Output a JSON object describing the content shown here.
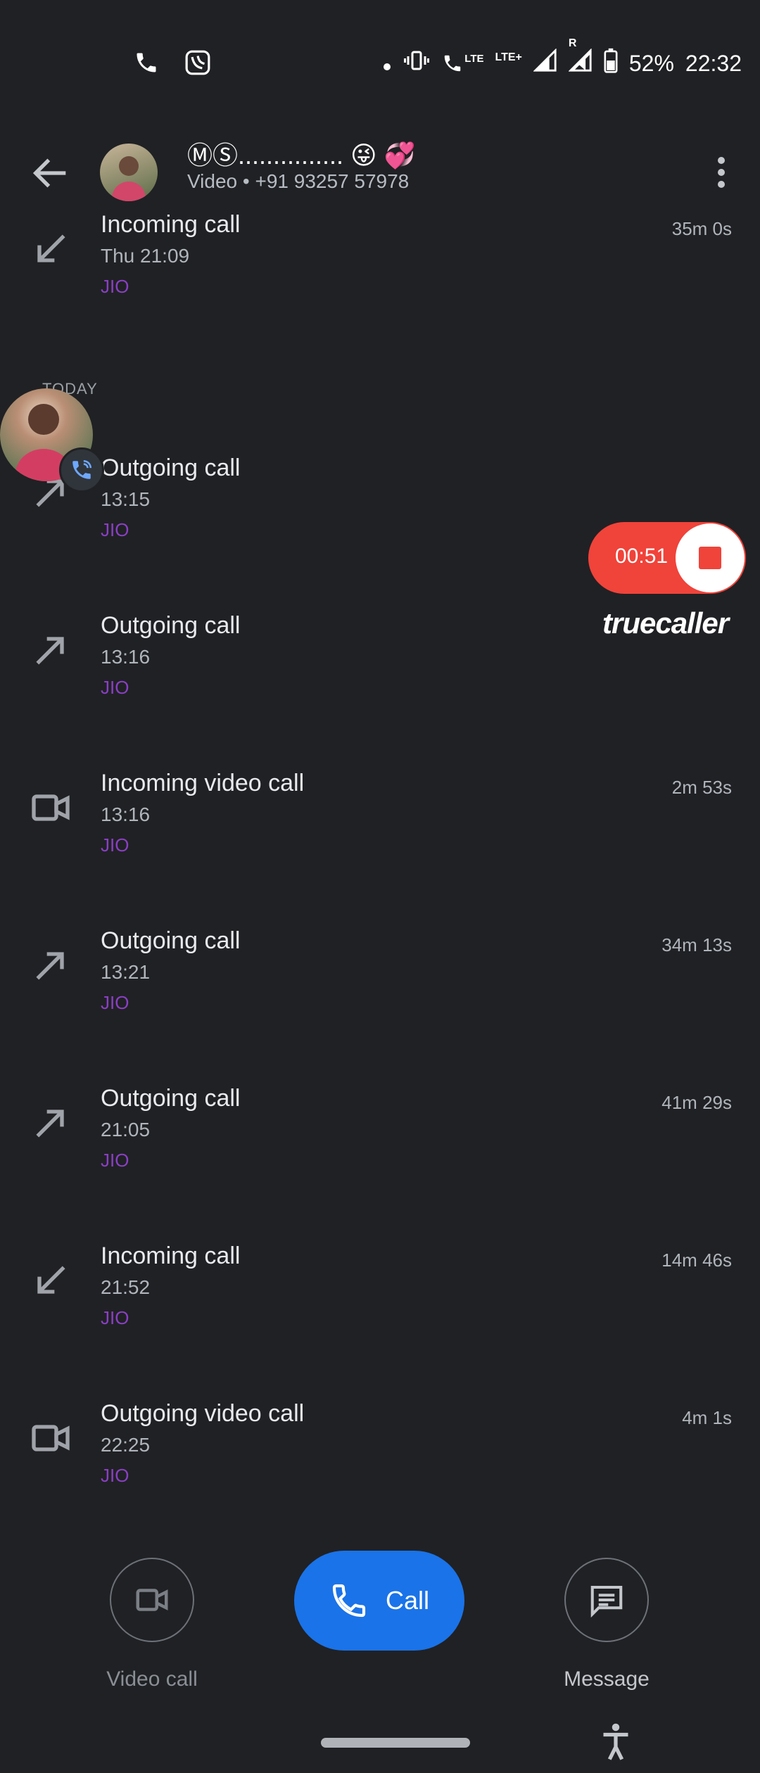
{
  "status_bar": {
    "battery": "52%",
    "clock": "22:32",
    "icons": [
      "phone-icon",
      "jiosaavn-icon",
      "dot-icon",
      "vibrate-icon",
      "volte-icon",
      "lte-plus-icon",
      "signal-icon",
      "roaming-signal-icon",
      "battery-icon"
    ],
    "network_label_1": "LTE",
    "network_label_2": "LTE+",
    "roaming_label": "R"
  },
  "header": {
    "contact_name": "ⓂⓈ............... 😜 💞",
    "subtitle": "Video • +91 93257 57978"
  },
  "entries": [
    {
      "icon": "incoming-call-icon",
      "title": "Incoming call",
      "time": "Thu 21:09",
      "sim": "JIO",
      "duration": "35m 0s"
    },
    {
      "icon": "outgoing-call-icon",
      "title": "Outgoing call",
      "time": "13:15",
      "sim": "JIO",
      "duration": ""
    },
    {
      "icon": "outgoing-call-icon",
      "title": "Outgoing call",
      "time": "13:16",
      "sim": "JIO",
      "duration": ""
    },
    {
      "icon": "video-call-icon",
      "title": "Incoming video call",
      "time": "13:16",
      "sim": "JIO",
      "duration": "2m 53s"
    },
    {
      "icon": "outgoing-call-icon",
      "title": "Outgoing call",
      "time": "13:21",
      "sim": "JIO",
      "duration": "34m 13s"
    },
    {
      "icon": "outgoing-call-icon",
      "title": "Outgoing call",
      "time": "21:05",
      "sim": "JIO",
      "duration": "41m 29s"
    },
    {
      "icon": "incoming-call-icon",
      "title": "Incoming call",
      "time": "21:52",
      "sim": "JIO",
      "duration": "14m 46s"
    },
    {
      "icon": "video-call-icon",
      "title": "Outgoing video call",
      "time": "22:25",
      "sim": "JIO",
      "duration": "4m 1s"
    }
  ],
  "day_label": "TODAY",
  "recorder": {
    "timer": "00:51",
    "brand": "truecaller",
    "accent": "#f0433a"
  },
  "actions": {
    "video_call_label": "Video call",
    "call_label": "Call",
    "message_label": "Message",
    "call_color": "#1a73e8"
  }
}
